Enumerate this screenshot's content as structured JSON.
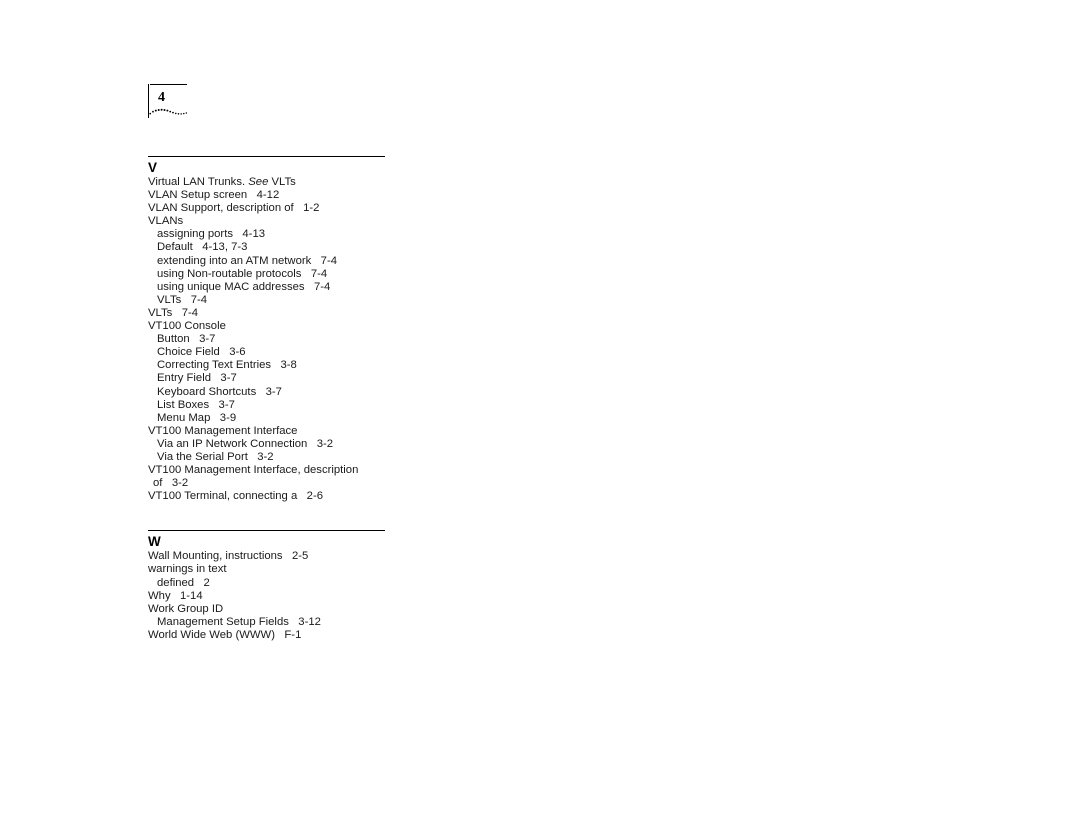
{
  "page_marker": {
    "number": "4",
    "decoration_icon": "dotted-wave-decoration"
  },
  "index": {
    "sections": [
      {
        "letter": "V",
        "entries": [
          {
            "level": 0,
            "text": "Virtual LAN Trunks. ",
            "italic": "See",
            "text_after": " VLTs"
          },
          {
            "level": 0,
            "text": "VLAN Setup screen   4-12"
          },
          {
            "level": 0,
            "text": "VLAN Support, description of   1-2"
          },
          {
            "level": 0,
            "text": "VLANs"
          },
          {
            "level": 1,
            "text": "assigning ports   4-13"
          },
          {
            "level": 1,
            "text": "Default   4-13, 7-3"
          },
          {
            "level": 1,
            "text": "extending into an ATM network   7-4"
          },
          {
            "level": 1,
            "text": "using Non-routable protocols   7-4"
          },
          {
            "level": 1,
            "text": "using unique MAC addresses   7-4"
          },
          {
            "level": 1,
            "text": "VLTs   7-4"
          },
          {
            "level": 0,
            "text": "VLTs   7-4"
          },
          {
            "level": 0,
            "text": "VT100 Console"
          },
          {
            "level": 1,
            "text": "Button   3-7"
          },
          {
            "level": 1,
            "text": "Choice Field   3-6"
          },
          {
            "level": 1,
            "text": "Correcting Text Entries   3-8"
          },
          {
            "level": 1,
            "text": "Entry Field   3-7"
          },
          {
            "level": 1,
            "text": "Keyboard Shortcuts   3-7"
          },
          {
            "level": 1,
            "text": "List Boxes   3-7"
          },
          {
            "level": 1,
            "text": "Menu Map   3-9"
          },
          {
            "level": 0,
            "text": "VT100 Management Interface"
          },
          {
            "level": 1,
            "text": "Via an IP Network Connection   3-2"
          },
          {
            "level": 1,
            "text": "Via the Serial Port   3-2"
          },
          {
            "level": 0,
            "text": "VT100 Management Interface, description"
          },
          {
            "level": 2,
            "text": "of   3-2"
          },
          {
            "level": 0,
            "text": "VT100 Terminal, connecting a   2-6"
          }
        ]
      },
      {
        "letter": "W",
        "entries": [
          {
            "level": 0,
            "text": "Wall Mounting, instructions   2-5"
          },
          {
            "level": 0,
            "text": "warnings in text"
          },
          {
            "level": 1,
            "text": "defined   2"
          },
          {
            "level": 0,
            "text": "Why   1-14"
          },
          {
            "level": 0,
            "text": "Work Group ID"
          },
          {
            "level": 1,
            "text": "Management Setup Fields   3-12"
          },
          {
            "level": 0,
            "text": "World Wide Web (WWW)   F-1"
          }
        ]
      }
    ]
  }
}
